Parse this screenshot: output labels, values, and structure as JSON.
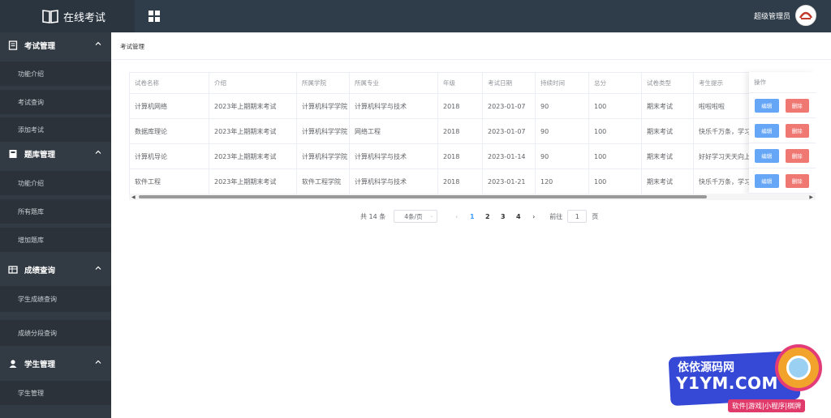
{
  "app": {
    "title": "在线考试",
    "user": "超级管理员"
  },
  "sidebar": {
    "groups": [
      {
        "label": "考试管理",
        "icon": "document-icon",
        "items": [
          "功能介绍",
          "考试查询",
          "添加考试"
        ]
      },
      {
        "label": "题库管理",
        "icon": "book-icon",
        "items": [
          "功能介绍",
          "所有题库",
          "增加题库"
        ]
      },
      {
        "label": "成绩查询",
        "icon": "table-icon",
        "items": [
          "学生成绩查询",
          "成绩分段查询"
        ]
      },
      {
        "label": "学生管理",
        "icon": "user-icon",
        "items": [
          "学生管理"
        ]
      }
    ]
  },
  "breadcrumb": "考试管理",
  "table": {
    "headers": [
      "试卷名称",
      "介绍",
      "所属学院",
      "所属专业",
      "年级",
      "考试日期",
      "持续时间",
      "总分",
      "试卷类型",
      "考生提示",
      "操作"
    ],
    "rows": [
      [
        "计算机网络",
        "2023年上期期末考试",
        "计算机科学学院",
        "计算机科学与技术",
        "2018",
        "2023-01-07",
        "90",
        "100",
        "期末考试",
        "啦啦啦啦"
      ],
      [
        "数据库理论",
        "2023年上期期末考试",
        "计算机科学学院",
        "网络工程",
        "2018",
        "2023-01-07",
        "90",
        "100",
        "期末考试",
        "快乐千万条，学习第一条"
      ],
      [
        "计算机导论",
        "2023年上期期末考试",
        "计算机科学学院",
        "计算机科学与技术",
        "2018",
        "2023-01-14",
        "90",
        "100",
        "期末考试",
        "好好学习天天向上"
      ],
      [
        "软件工程",
        "2023年上期期末考试",
        "软件工程学院",
        "计算机科学与技术",
        "2018",
        "2023-01-21",
        "120",
        "100",
        "期末考试",
        "快乐千万条，学习第一条"
      ]
    ],
    "edit_label": "编辑",
    "delete_label": "删除"
  },
  "pagination": {
    "total": "共 14 条",
    "page_size": "4条/页",
    "pages": [
      "1",
      "2",
      "3",
      "4"
    ],
    "current": "1",
    "goto_prefix": "前往",
    "goto_value": "1",
    "goto_suffix": "页"
  },
  "watermark": {
    "title": "依依源码网",
    "domain": "Y1YM.COM",
    "tagline": "软件|游戏|小程序|棋牌"
  },
  "colors": {
    "topbar": "#2f3d4a",
    "sidebar": "#323a43",
    "edit": "#66a6f7",
    "delete": "#f07873",
    "active_page": "#409eff"
  }
}
